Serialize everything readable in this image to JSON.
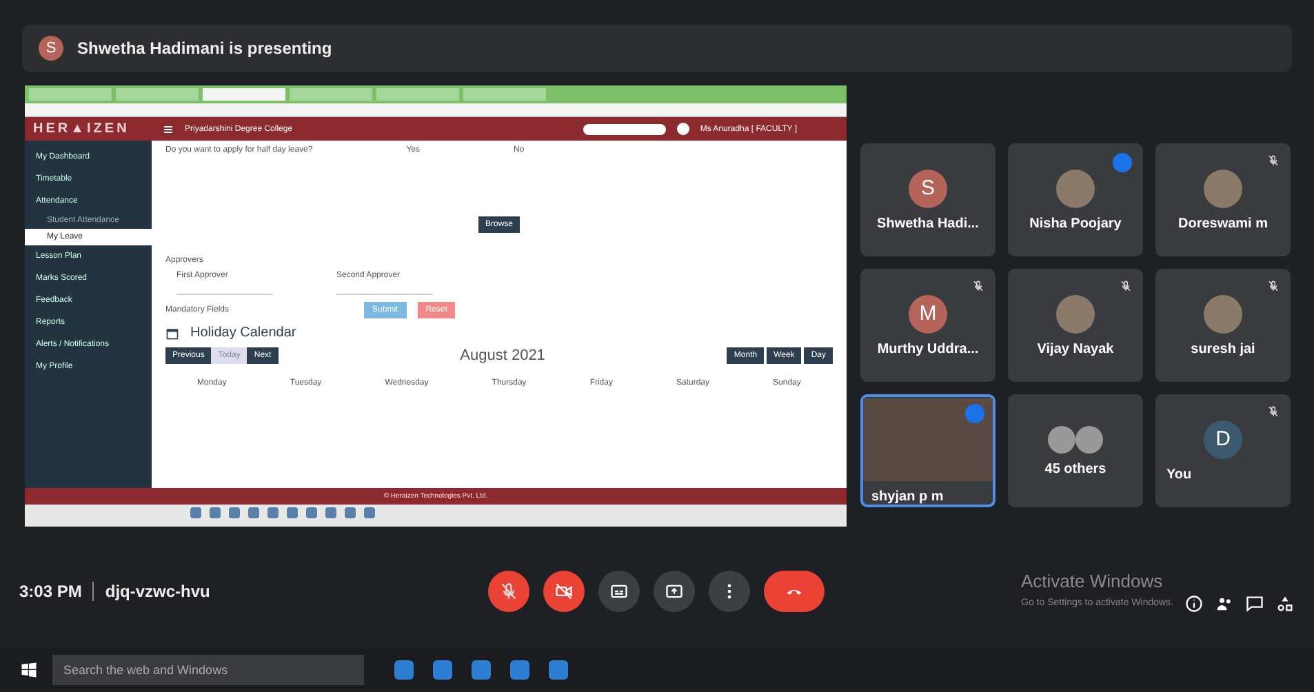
{
  "presenter_bar": {
    "initial": "S",
    "text": "Shwetha Hadimani is presenting"
  },
  "shared_screen": {
    "browser_tabs": [
      {
        "selected": false
      },
      {
        "selected": false
      },
      {
        "selected": true
      },
      {
        "selected": false
      },
      {
        "selected": false
      },
      {
        "selected": false
      }
    ],
    "app": {
      "logo": "HER▲IZEN",
      "college": "Priyadarshini Degree College",
      "user": "Ms Anuradha [ FACULTY ]",
      "sidebar": [
        {
          "label": "My Dashboard",
          "selected": false
        },
        {
          "label": "Timetable",
          "selected": false
        },
        {
          "label": "Attendance",
          "selected": false,
          "children": [
            {
              "label": "Student Attendance",
              "selected": false
            },
            {
              "label": "My Leave",
              "selected": true
            }
          ]
        },
        {
          "label": "Lesson Plan",
          "selected": false
        },
        {
          "label": "Marks Scored",
          "selected": false
        },
        {
          "label": "Feedback",
          "selected": false
        },
        {
          "label": "Reports",
          "selected": false
        },
        {
          "label": "Alerts / Notifications",
          "selected": false
        },
        {
          "label": "My Profile",
          "selected": false
        }
      ],
      "half_day_question": "Do you want to apply for half day leave?",
      "half_day_options": [
        "Yes",
        "No"
      ],
      "browse_button": "Browse",
      "approvers_label": "Approvers",
      "first_approver_label": "First Approver",
      "second_approver_label": "Second Approver",
      "mandatory_note": "Mandatory Fields",
      "submit_button": "Submit",
      "reset_button": "Reset",
      "calendar": {
        "title": "Holiday Calendar",
        "nav": [
          {
            "label": "Previous",
            "disabled": false
          },
          {
            "label": "Today",
            "disabled": true
          },
          {
            "label": "Next",
            "disabled": false
          }
        ],
        "month": "August 2021",
        "views": [
          "Month",
          "Week",
          "Day"
        ],
        "weekdays": [
          "Monday",
          "Tuesday",
          "Wednesday",
          "Thursday",
          "Friday",
          "Saturday",
          "Sunday"
        ]
      },
      "footer": "© Heraizen Technologies Pvt. Ltd."
    }
  },
  "participants": [
    {
      "name": "Shwetha Hadi...",
      "kind": "initial",
      "initial": "S",
      "color": "#b5645a",
      "muted": false,
      "speaking": false,
      "selected": false
    },
    {
      "name": "Nisha Poojary",
      "kind": "photo",
      "muted": false,
      "speaking": true,
      "selected": false
    },
    {
      "name": "Doreswami m",
      "kind": "photo",
      "muted": true,
      "speaking": false,
      "selected": false
    },
    {
      "name": "Murthy Uddra...",
      "kind": "initial",
      "initial": "M",
      "color": "#b5645a",
      "muted": true,
      "speaking": false,
      "selected": false
    },
    {
      "name": "Vijay Nayak",
      "kind": "photo",
      "muted": true,
      "speaking": false,
      "selected": false
    },
    {
      "name": "suresh jai",
      "kind": "photo",
      "muted": true,
      "speaking": false,
      "selected": false
    },
    {
      "name": "shyjan p m",
      "kind": "video",
      "muted": false,
      "speaking": true,
      "selected": true
    },
    {
      "name": "45 others",
      "kind": "others",
      "muted": false,
      "speaking": false,
      "selected": false
    },
    {
      "name": "You",
      "kind": "initial",
      "initial": "D",
      "color": "#3c5a6e",
      "muted": true,
      "speaking": false,
      "selected": false
    }
  ],
  "meeting_bar": {
    "time": "3:03 PM",
    "code": "djq-vzwc-hvu",
    "controls": [
      {
        "kind": "mic",
        "off": true
      },
      {
        "kind": "camera",
        "off": true
      },
      {
        "kind": "captions",
        "off": false
      },
      {
        "kind": "present",
        "off": false
      },
      {
        "kind": "more",
        "off": false
      },
      {
        "kind": "hangup"
      }
    ],
    "activation_title": "Activate Windows",
    "activation_text": "Go to Settings to activate Windows."
  },
  "taskbar": {
    "search_placeholder": "Search the web and Windows"
  }
}
